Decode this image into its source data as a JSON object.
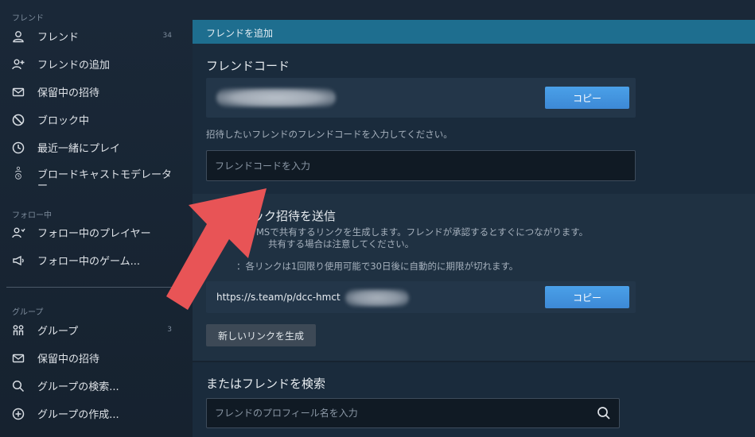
{
  "sidebar": {
    "friends_section": "フレンド",
    "items": [
      {
        "label": "フレンド",
        "count": "34",
        "icon": "person-icon"
      },
      {
        "label": "フレンドの追加",
        "icon": "person-add-icon"
      },
      {
        "label": "保留中の招待",
        "icon": "envelope-icon"
      },
      {
        "label": "ブロック中",
        "icon": "block-icon"
      },
      {
        "label": "最近一緒にプレイ",
        "icon": "clock-icon"
      },
      {
        "label": "ブロードキャストモデレータ",
        "label2": "ー",
        "icon": "person-clock-icon"
      }
    ],
    "following_section": "フォロー中",
    "following_items": [
      {
        "label": "フォロー中のプレイヤー",
        "icon": "person-follow-icon"
      },
      {
        "label": "フォロー中のゲーム...",
        "icon": "megaphone-icon"
      }
    ],
    "groups_section": "グループ",
    "group_items": [
      {
        "label": "グループ",
        "count": "3",
        "icon": "group-icon"
      },
      {
        "label": "保留中の招待",
        "icon": "envelope-icon"
      },
      {
        "label": "グループの検索...",
        "icon": "search-icon"
      },
      {
        "label": "グループの作成...",
        "icon": "plus-circle-icon"
      }
    ]
  },
  "main": {
    "header": "フレンドを追加",
    "friend_code": {
      "title": "フレンドコード",
      "copy_label": "コピー",
      "instruction": "招待したいフレンドのフレンドコードを入力してください。",
      "input_placeholder": "フレンドコードを入力"
    },
    "quick_invite": {
      "title": "ック招待を送信",
      "desc1": "MSで共有するリンクを生成します。フレンドが承認するとすぐにつながります。",
      "desc2": "共有する場合は注意してください。",
      "note": "：各リンクは1回限り使用可能で30日後に自動的に期限が切れます。",
      "link": "https://s.team/p/dcc-hmct",
      "copy_label": "コピー",
      "generate_label": "新しいリンクを生成"
    },
    "search": {
      "title": "またはフレンドを検索",
      "placeholder": "フレンドのプロフィール名を入力"
    }
  },
  "colors": {
    "header": "#1e6e8f",
    "copy_button": "#4a9ce6",
    "arrow": "#e85456"
  }
}
